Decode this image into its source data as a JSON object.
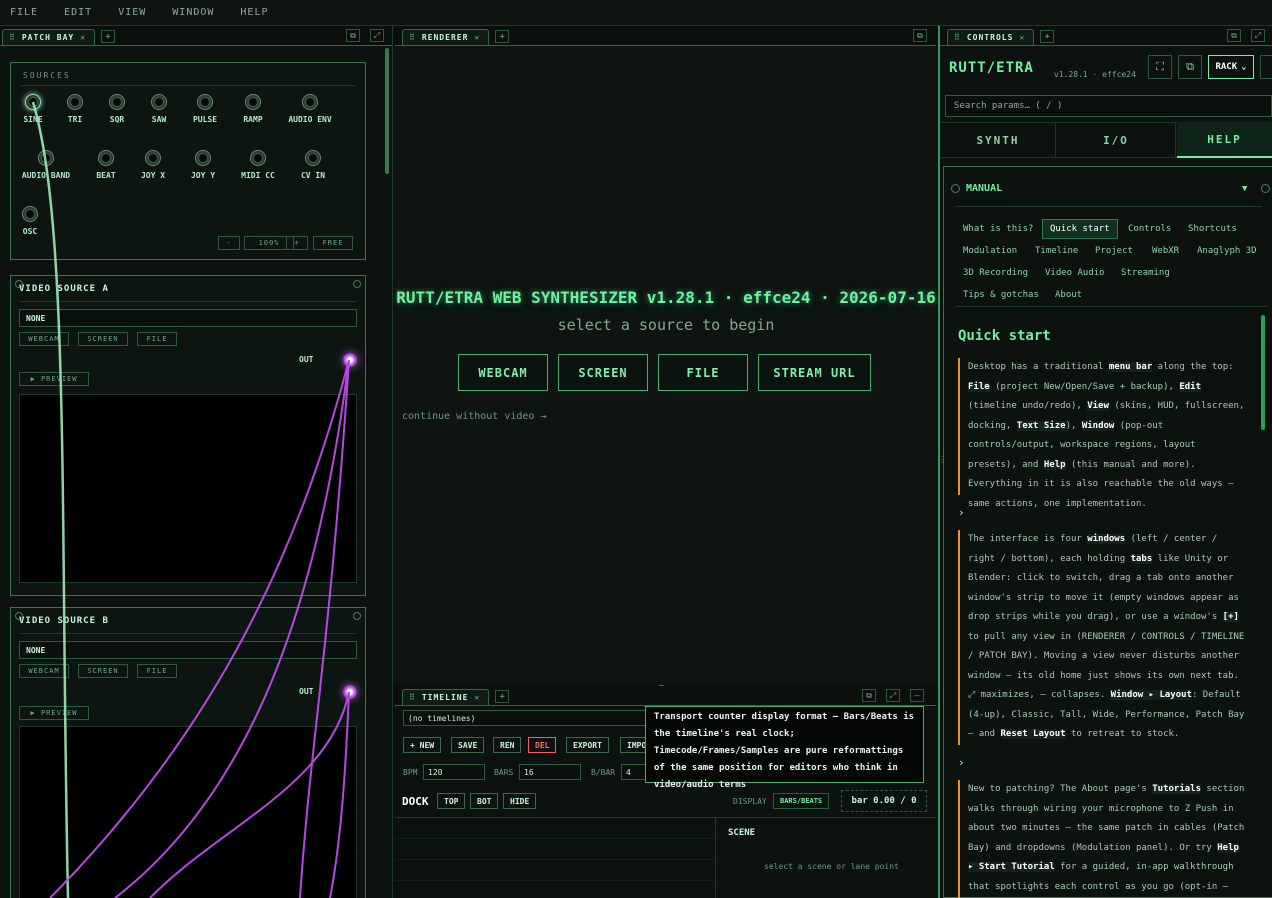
{
  "menu": [
    "FILE",
    "EDIT",
    "VIEW",
    "WINDOW",
    "HELP"
  ],
  "patch_bay": {
    "tab": "PATCH BAY",
    "sources_title": "SOURCES",
    "jacks": [
      "SINE",
      "TRI",
      "SQR",
      "SAW",
      "PULSE",
      "RAMP",
      "AUDIO ENV",
      "AUDIO BAND",
      "BEAT",
      "JOY X",
      "JOY Y",
      "MIDI CC",
      "CV IN",
      "OSC"
    ],
    "zoom": {
      "minus": "-",
      "level": "100%",
      "plus": "+",
      "free": "FREE"
    },
    "video_a": {
      "title": "VIDEO SOURCE A",
      "value": "NONE",
      "buttons": [
        "WEBCAM",
        "SCREEN",
        "FILE"
      ],
      "out": "OUT",
      "preview": "▶ PREVIEW"
    },
    "video_b": {
      "title": "VIDEO SOURCE B",
      "value": "NONE",
      "buttons": [
        "WEBCAM",
        "SCREEN",
        "FILE"
      ],
      "out": "OUT",
      "preview": "▶ PREVIEW"
    }
  },
  "renderer": {
    "tab": "RENDERER",
    "title": "RUTT/ETRA WEB SYNTHESIZER v1.28.1 · effce24 · 2026-07-16",
    "subtitle": "select a source to begin",
    "buttons": [
      "WEBCAM",
      "SCREEN",
      "FILE",
      "STREAM URL"
    ],
    "continue": "continue without video →"
  },
  "timeline": {
    "tab": "TIMELINE",
    "select": "(no timelines)",
    "buttons": {
      "new": "+ NEW",
      "save": "SAVE",
      "ren": "REN",
      "del": "DEL",
      "export": "EXPORT",
      "import": "IMPO"
    },
    "bpm_label": "BPM",
    "bpm": "120",
    "bars_label": "BARS",
    "bars": "16",
    "bbar_label": "B/BAR",
    "bbar": "4",
    "dock_label": "DOCK",
    "dock_buttons": [
      "TOP",
      "BOT",
      "HIDE"
    ],
    "display_label": "DISPLAY",
    "display_value": "BARS/BEATS",
    "counter": "bar 0.00 / 0",
    "scene_title": "SCENE",
    "scene_hint": "select a scene or lane point",
    "tooltip": "Transport counter display format — Bars/Beats is the timeline's real clock; Timecode/Frames/Samples are pure reformattings of the same position for editors who think in video/audio terms"
  },
  "controls": {
    "tab": "CONTROLS",
    "brand": "RUTT/ETRA",
    "version": "v1.28.1 · effce24",
    "rack": "RACK",
    "search_placeholder": "Search params…  ( / )",
    "tabs": [
      "SYNTH",
      "I/O",
      "HELP"
    ],
    "manual_title": "MANUAL",
    "manual_toggle": "▼",
    "subtabs": [
      "What is this?",
      "Quick start",
      "Controls",
      "Shortcuts",
      "Modulation",
      "Timeline",
      "Project",
      "WebXR",
      "Anaglyph 3D",
      "3D Recording",
      "Video Audio",
      "Streaming",
      "Tips & gotchas",
      "About"
    ],
    "section_title": "Quick start",
    "chevron": "›"
  },
  "colors": {
    "accent": "#6ef0a0",
    "cable_green": "#9ee8b8",
    "cable_purple": "#b548e0",
    "warn": "#e3962e",
    "danger": "#ff5a5a"
  }
}
